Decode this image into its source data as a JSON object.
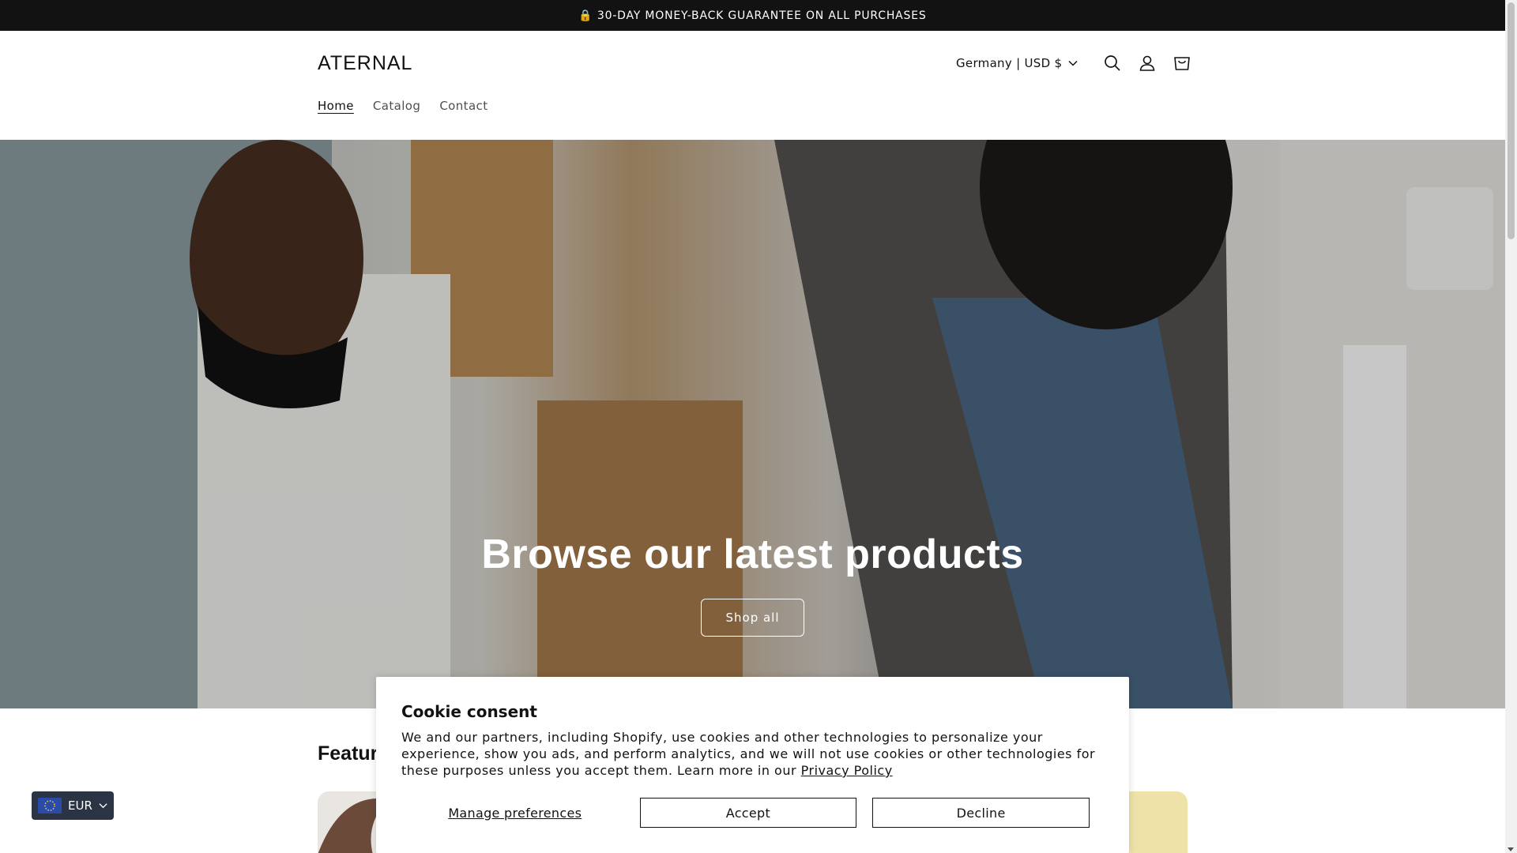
{
  "announcement": {
    "text": "🔒 30-DAY MONEY-BACK GUARANTEE ON ALL PURCHASES"
  },
  "header": {
    "logo": "ATERNAL",
    "country_selector": "Germany | USD $",
    "nav": [
      {
        "label": "Home",
        "active": true
      },
      {
        "label": "Catalog",
        "active": false
      },
      {
        "label": "Contact",
        "active": false
      }
    ],
    "icons": [
      "search-icon",
      "account-icon",
      "cart-icon"
    ]
  },
  "hero": {
    "title": "Browse our latest products",
    "button_label": "Shop all"
  },
  "featured": {
    "title": "Featur"
  },
  "cookie": {
    "title": "Cookie consent",
    "text": "We and our partners, including Shopify, use cookies and other technologies to personalize your experience, show you ads, and perform analytics, and we will not use cookies or other technologies for these purposes unless you accept them. Learn more in our ",
    "link": "Privacy Policy",
    "manage": "Manage preferences",
    "accept": "Accept",
    "decline": "Decline"
  },
  "currency_widget": {
    "label": "EUR"
  },
  "colors": {
    "announcement_bg": "#121212",
    "currency_bg": "#2a3444",
    "accent": "#121212"
  }
}
